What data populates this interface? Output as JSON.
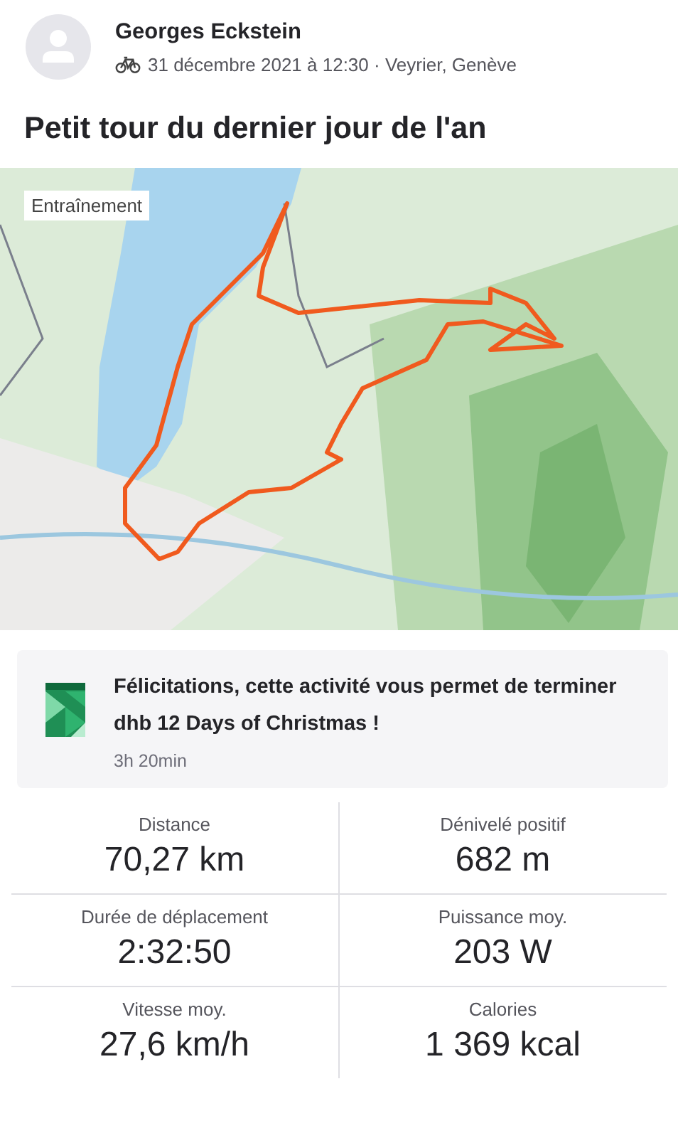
{
  "athlete": {
    "name": "Georges Eckstein",
    "details": "31 décembre 2021 à 12:30 · Veyrier, Genève"
  },
  "title": "Petit tour du dernier jour de l'an",
  "map": {
    "kind": "picture",
    "badge": "Entraînement"
  },
  "challenge": {
    "message": "Félicitations, cette activité vous permet de terminer dhb 12 Days of Christmas !",
    "time": "3h 20min"
  },
  "stats": [
    {
      "label": "Distance",
      "value": "70,27 km"
    },
    {
      "label": "Dénivelé positif",
      "value": "682 m"
    },
    {
      "label": "Durée de déplacement",
      "value": "2:32:50"
    },
    {
      "label": "Puissance moy.",
      "value": "203 W"
    },
    {
      "label": "Vitesse moy.",
      "value": "27,6 km/h"
    },
    {
      "label": "Calories",
      "value": "1 369 kcal"
    }
  ]
}
